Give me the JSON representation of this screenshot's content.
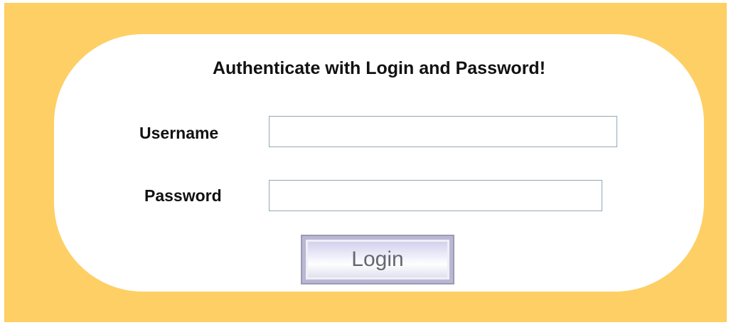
{
  "login_form": {
    "title": "Authenticate with Login and Password!",
    "username_label": "Username",
    "username_value": "",
    "password_label": "Password",
    "password_value": "",
    "login_label": "Login"
  },
  "colors": {
    "background": "#fecf64",
    "panel": "#ffffff",
    "field_border": "#8fa9b9",
    "button_tint": "#c6c6e8"
  }
}
